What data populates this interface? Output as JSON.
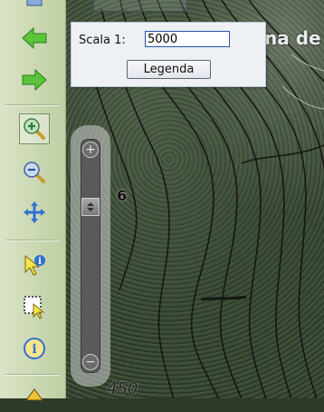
{
  "map": {
    "place_label": "na de",
    "contour_label_1": "6",
    "contour_label_2": "450"
  },
  "scale_panel": {
    "label": "Scala 1:",
    "value": "5000",
    "legend_button": "Legenda"
  },
  "toolbar": {
    "tools": [
      {
        "name": "back-arrow-icon"
      },
      {
        "name": "forward-arrow-icon"
      },
      {
        "name": "zoom-in-icon"
      },
      {
        "name": "zoom-out-icon"
      },
      {
        "name": "pan-icon"
      },
      {
        "name": "identify-pointer-icon"
      },
      {
        "name": "select-box-icon"
      },
      {
        "name": "info-icon"
      }
    ]
  },
  "zoom_slider": {
    "plus": "+",
    "minus": "−",
    "level": 0.22
  },
  "colors": {
    "toolbar_bg": "#c9d7b1",
    "arrow_green": "#5cc43a",
    "panel_bg": "#eef1f3",
    "input_border": "#2a52a8"
  }
}
